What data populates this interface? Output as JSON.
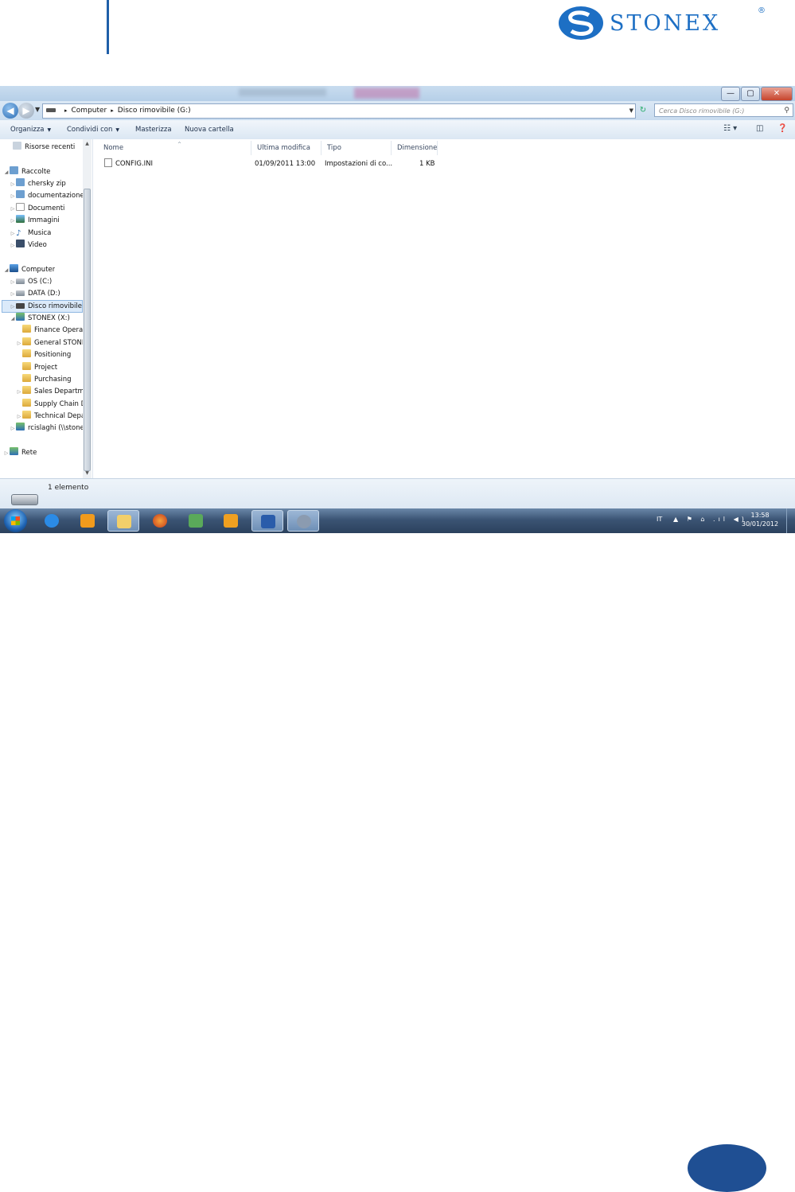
{
  "document": {
    "logo_text": "STONEX",
    "logo_reg": "®"
  },
  "explorer": {
    "window_buttons": {
      "minimize": "—",
      "maximize": "▢",
      "close": "✕"
    },
    "address_bar": {
      "segments": [
        "Computer",
        "Disco rimovibile (G:)"
      ],
      "separator": "▸"
    },
    "search": {
      "placeholder": "Cerca Disco rimovibile (G:)"
    },
    "commands": {
      "organize": "Organizza",
      "share": "Condividi con",
      "burn": "Masterizza",
      "new_folder": "Nuova cartella"
    },
    "nav_pane": [
      {
        "label": "Risorse recenti",
        "icon": "recent-icon"
      },
      {
        "label": "Raccolte",
        "icon": "library-icon"
      },
      {
        "label": "chersky zip",
        "icon": "library-icon"
      },
      {
        "label": "documentazione",
        "icon": "library-icon"
      },
      {
        "label": "Documenti",
        "icon": "document-icon"
      },
      {
        "label": "Immagini",
        "icon": "image-icon"
      },
      {
        "label": "Musica",
        "icon": "music-icon"
      },
      {
        "label": "Video",
        "icon": "video-icon"
      },
      {
        "label": "Computer",
        "icon": "computer-icon"
      },
      {
        "label": "OS (C:)",
        "icon": "drive-icon"
      },
      {
        "label": "DATA (D:)",
        "icon": "drive-icon"
      },
      {
        "label": "Disco rimovibile",
        "icon": "removable-drive-icon"
      },
      {
        "label": "STONEX (X:)",
        "icon": "network-drive-icon"
      },
      {
        "label": "Finance Operat",
        "icon": "folder-icon"
      },
      {
        "label": "General STONE",
        "icon": "folder-icon"
      },
      {
        "label": "Positioning",
        "icon": "folder-icon"
      },
      {
        "label": "Project",
        "icon": "folder-icon"
      },
      {
        "label": "Purchasing",
        "icon": "folder-icon"
      },
      {
        "label": "Sales Departme",
        "icon": "folder-icon"
      },
      {
        "label": "Supply Chain D",
        "icon": "folder-icon"
      },
      {
        "label": "Technical Depa",
        "icon": "folder-icon"
      },
      {
        "label": "rcislaghi (\\\\stone",
        "icon": "network-drive-icon"
      },
      {
        "label": "Rete",
        "icon": "network-icon"
      }
    ],
    "columns": {
      "name": "Nome",
      "modified": "Ultima modifica",
      "type": "Tipo",
      "size": "Dimensione"
    },
    "files": [
      {
        "name": "CONFIG.INI",
        "modified": "01/09/2011 13:00",
        "type": "Impostazioni di co...",
        "size": "1 KB"
      }
    ],
    "details": {
      "count": "1 elemento"
    }
  },
  "taskbar": {
    "lang": "IT",
    "tray_icons": "▲ ⚑ ⌂ .ıl ◀)",
    "time": "13:58",
    "date": "30/01/2012",
    "apps": [
      "internet-explorer-icon",
      "media-player-icon",
      "explorer-icon",
      "firefox-icon",
      "messenger-icon",
      "outlook-icon",
      "word-icon",
      "satellite-icon"
    ]
  }
}
